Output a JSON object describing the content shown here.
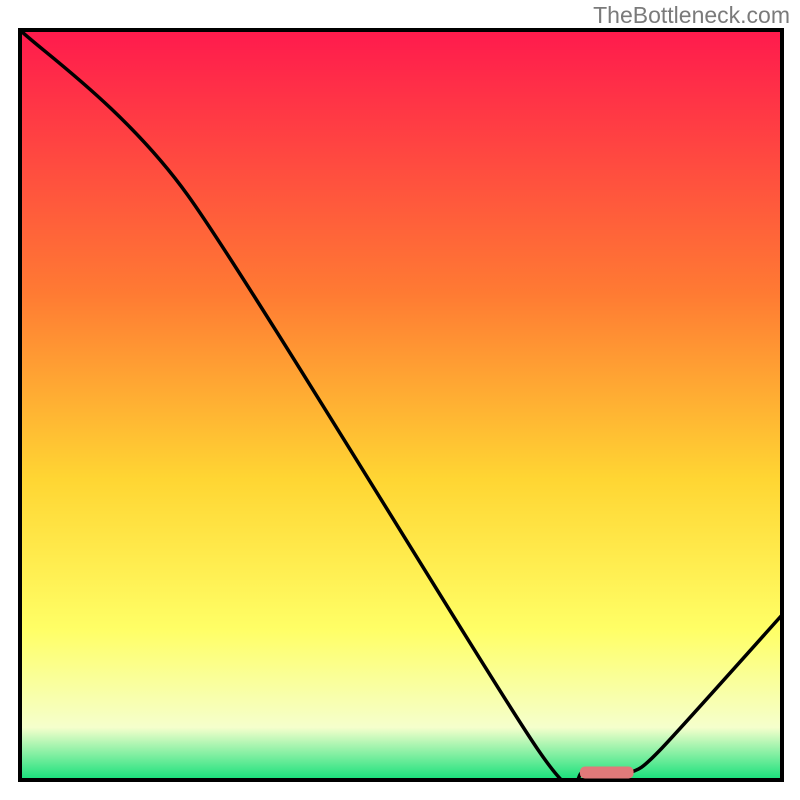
{
  "watermark": "TheBottleneck.com",
  "colors": {
    "outline": "#000000",
    "curve": "#000000",
    "marker": "#e07a7a",
    "gradient_top": "#ff1a4d",
    "gradient_mid1": "#ff7a33",
    "gradient_mid2": "#ffd633",
    "gradient_mid3": "#ffff66",
    "gradient_mid4": "#f5ffcc",
    "gradient_bottom": "#15e07a"
  },
  "chart_data": {
    "type": "line",
    "title": "",
    "xlabel": "",
    "ylabel": "",
    "xlim": [
      0,
      100
    ],
    "ylim": [
      0,
      100
    ],
    "annotations": [],
    "series": [
      {
        "name": "bottleneck-curve",
        "x": [
          0,
          22,
          68,
          74,
          80,
          84,
          100
        ],
        "y": [
          100,
          78,
          4,
          1,
          1,
          4,
          22
        ]
      }
    ],
    "optimum_marker": {
      "x_start": 74,
      "x_end": 80,
      "y": 1
    }
  }
}
